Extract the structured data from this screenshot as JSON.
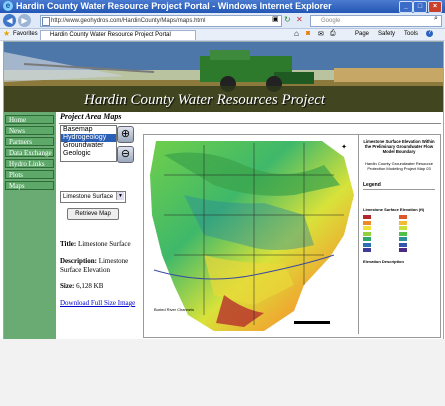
{
  "window": {
    "title": "Hardin County Water Resource Project Portal - Windows Internet Explorer",
    "url": "http://www.geohydros.com/HardinCounty/Maps/maps.html",
    "search_placeholder": "Google"
  },
  "favorites": {
    "label": "Favorites",
    "tab_title": "Hardin County Water Resource Project Portal"
  },
  "commands": {
    "page": "Page",
    "safety": "Safety",
    "tools": "Tools"
  },
  "banner": {
    "title": "Hardin County Water Resources Project"
  },
  "nav": [
    "Home",
    "News",
    "Partners",
    "Data Exchange",
    "Hydro Links",
    "Plots",
    "Maps"
  ],
  "main": {
    "heading": "Project Area Maps",
    "map_layers": [
      "Basemap",
      "Hydrogeology",
      "Groundwater",
      "Geologic"
    ],
    "selected_layer": "Hydrogeology",
    "map_select_value": "Limestone Surface",
    "retrieve_button": "Retrieve Map",
    "info": {
      "title_label": "Title:",
      "title_value": "Limestone Surface",
      "description_label": "Description:",
      "description_value_line1": "Limestone",
      "description_value_line2": "Surface Elevation",
      "size_label": "Size:",
      "size_value": "6,128 KB",
      "download_link": "Download Full Size Image"
    }
  },
  "map_legend": {
    "title": "Limestone Surface Elevation Within the Preliminary Groundwater Flow Model Boundary",
    "subtitle": "Hardin County Groundwater Resource Protection Modeling Project Map 03",
    "legend_heading": "Legend",
    "elevation_heading": "Limestone Surface Elevation (ft)",
    "elevation_description_heading": "Elevation Description",
    "elevation_ramp": [
      "#b3262c",
      "#d9572b",
      "#e98a2b",
      "#f2bb33",
      "#f1df3a",
      "#c8e03a",
      "#8fd23c",
      "#4fc04a",
      "#2fa86a",
      "#2a8f9a",
      "#2f6fb5",
      "#3454b0",
      "#3d3a99",
      "#4a2a82"
    ],
    "river_label": "Buried River Channels"
  },
  "colors": {
    "nav_green": "#5ea86a",
    "link_blue": "#0000cc",
    "selection_blue": "#2a5fb8"
  }
}
